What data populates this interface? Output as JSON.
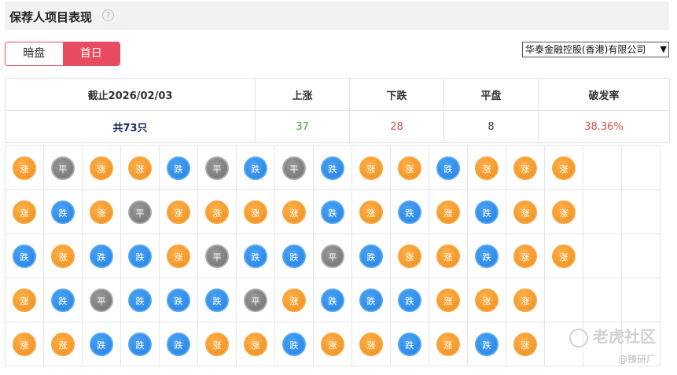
{
  "header": {
    "title": "保荐人项目表现",
    "help_glyph": "?"
  },
  "tabs": [
    {
      "label": "暗盘"
    },
    {
      "label": "首日"
    }
  ],
  "broker_select": {
    "value": "华泰金融控股(香港)有限公司"
  },
  "summary": {
    "headers": [
      "截止2026/02/03",
      "上涨",
      "下跌",
      "平盘",
      "破发率"
    ],
    "values": {
      "total": "共73只",
      "up": "37",
      "down": "28",
      "flat": "8",
      "break_rate": "38.36%"
    }
  },
  "legend_labels": {
    "up": "涨",
    "down": "跌",
    "flat": "平"
  },
  "grid_rows": [
    [
      "up",
      "flat",
      "up",
      "up",
      "down",
      "flat",
      "down",
      "flat",
      "down",
      "up",
      "up",
      "down",
      "up",
      "up",
      "up"
    ],
    [
      "up",
      "down",
      "up",
      "flat",
      "up",
      "up",
      "up",
      "up",
      "down",
      "up",
      "down",
      "up",
      "down",
      "up",
      "up"
    ],
    [
      "down",
      "up",
      "down",
      "down",
      "up",
      "flat",
      "down",
      "down",
      "flat",
      "down",
      "up",
      "up",
      "down",
      "up",
      "up"
    ],
    [
      "up",
      "down",
      "flat",
      "down",
      "down",
      "down",
      "flat",
      "up",
      "down",
      "down",
      "down",
      "up",
      "up",
      "up"
    ],
    [
      "up",
      "up",
      "down",
      "down",
      "down",
      "up",
      "up",
      "down",
      "up",
      "up",
      "down",
      "up",
      "down",
      "up"
    ]
  ],
  "watermark": {
    "main": "老虎社区",
    "sub": "@臻研厂"
  },
  "colors": {
    "accent": "#e84a5f",
    "up": "#f08c1a",
    "down": "#2280e0",
    "flat": "#6e6e6e",
    "up_text": "#3aa63a",
    "down_text": "#d05050"
  }
}
